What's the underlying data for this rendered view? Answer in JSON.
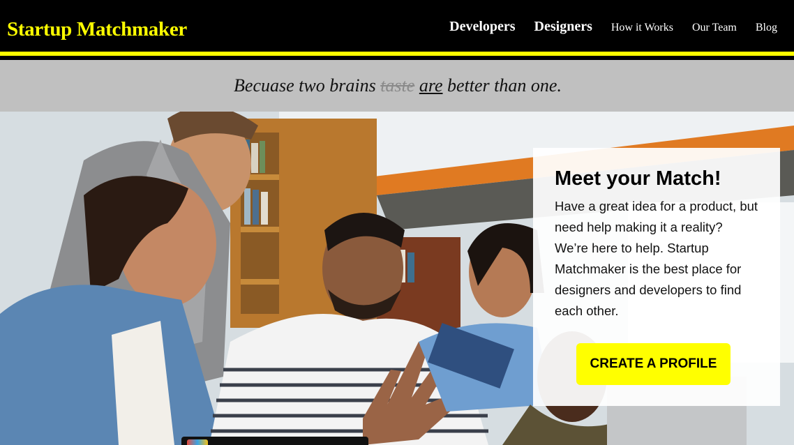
{
  "header": {
    "brand": "Startup Matchmaker",
    "nav": {
      "developers": "Developers",
      "designers": "Designers",
      "how_it_works": "How it Works",
      "our_team": "Our Team",
      "blog": "Blog"
    }
  },
  "tagline": {
    "part1": "Becuase two brains ",
    "struck": "taste",
    "underlined": "are",
    "part2": " better than one",
    "end": "."
  },
  "hero": {
    "image_description": "photo-students-collaborating-in-library",
    "card": {
      "title": "Meet your Match!",
      "body": "Have a great idea for a product, but need help making it a reality? We’re here to help. Startup Matchmaker is the best place for designers and developers to find each other.",
      "cta_label": "CREATE A PROFILE"
    }
  },
  "colors": {
    "accent": "#ffff00",
    "header_bg": "#000000",
    "band_bg": "#c0c0c0"
  }
}
